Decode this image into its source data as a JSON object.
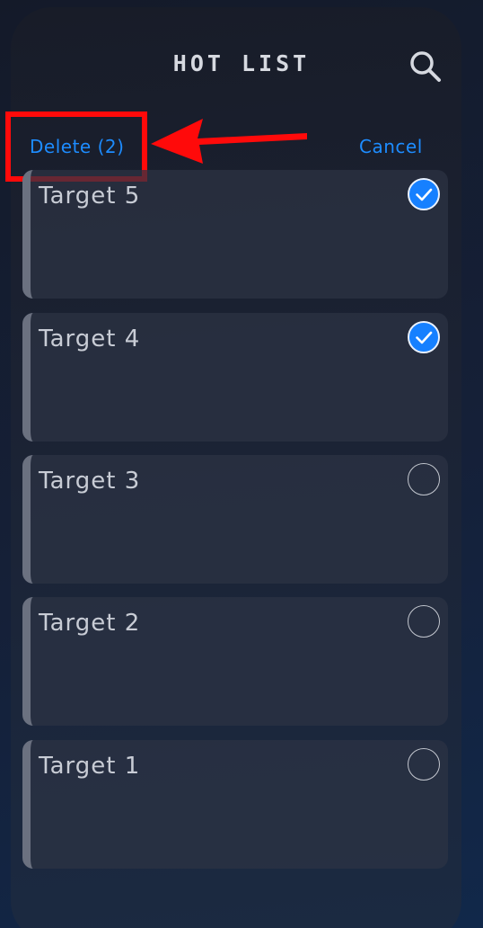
{
  "header": {
    "title": "HOT LIST",
    "search_icon": "search-icon"
  },
  "toolbar": {
    "delete_label": "Delete (2)",
    "cancel_label": "Cancel"
  },
  "annotation": {
    "highlight_color": "#ff0a0a",
    "target": "delete-button"
  },
  "colors": {
    "accent": "#1d8cff",
    "checked": "#1680ff"
  },
  "items": [
    {
      "label": "Target 5",
      "selected": true
    },
    {
      "label": "Target 4",
      "selected": true
    },
    {
      "label": "Target 3",
      "selected": false
    },
    {
      "label": "Target 2",
      "selected": false
    },
    {
      "label": "Target 1",
      "selected": false
    }
  ]
}
